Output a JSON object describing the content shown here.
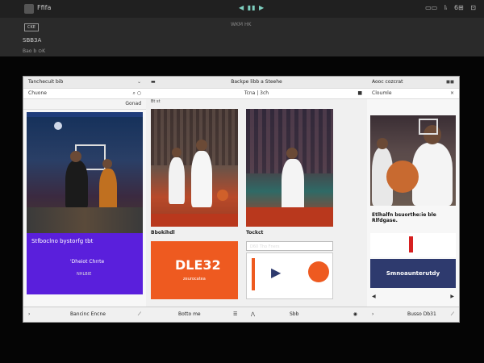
{
  "topbar": {
    "app_name": "Ffifa",
    "controls": "◀ ▮▮ ▶",
    "right_items": [
      "▭▭",
      "lᵢ",
      "6⊞",
      "⊡"
    ]
  },
  "subbar": {
    "badge": "CKE",
    "title": "WKM HK",
    "label": "SBB3A",
    "sublabel": "Bao b ⊙K"
  },
  "panel1": {
    "header": "Tanchecuit bib",
    "header_icon": "⌄",
    "tab": "Chuone",
    "tab_action": "Gonad",
    "banner_title": "Stfboclno bystorfg tbt",
    "banner_body": "'Dheiot Chrrte",
    "banner_note": "NHLBIE",
    "footer": "Bancinc Encne"
  },
  "panel2": {
    "header": "Backpe libb a Steehe",
    "tab": "Tcna | 3ch",
    "card_a_caption": "Bbokihdl",
    "card_a_title": "DLE32",
    "card_a_sub": "zeurocatea",
    "card_a_footer": "Botto me",
    "card_b_caption": "Tockct",
    "card_b_input": "D60 Tho Fners",
    "card_b_footer": "Sbb",
    "left_label": "Bt st"
  },
  "panel3": {
    "header": "Aooc cozcrat",
    "tab": "Cloumle",
    "headline": "Etlhalfn bsuorthe:ie ble Rlfdgase.",
    "promo": "Smnoaunterutdy",
    "footer": "Busso Db31"
  },
  "colors": {
    "purple": "#5a1fdc",
    "orange": "#ee5a20",
    "navy": "#2e3a6e",
    "court_red": "#b9381d"
  }
}
